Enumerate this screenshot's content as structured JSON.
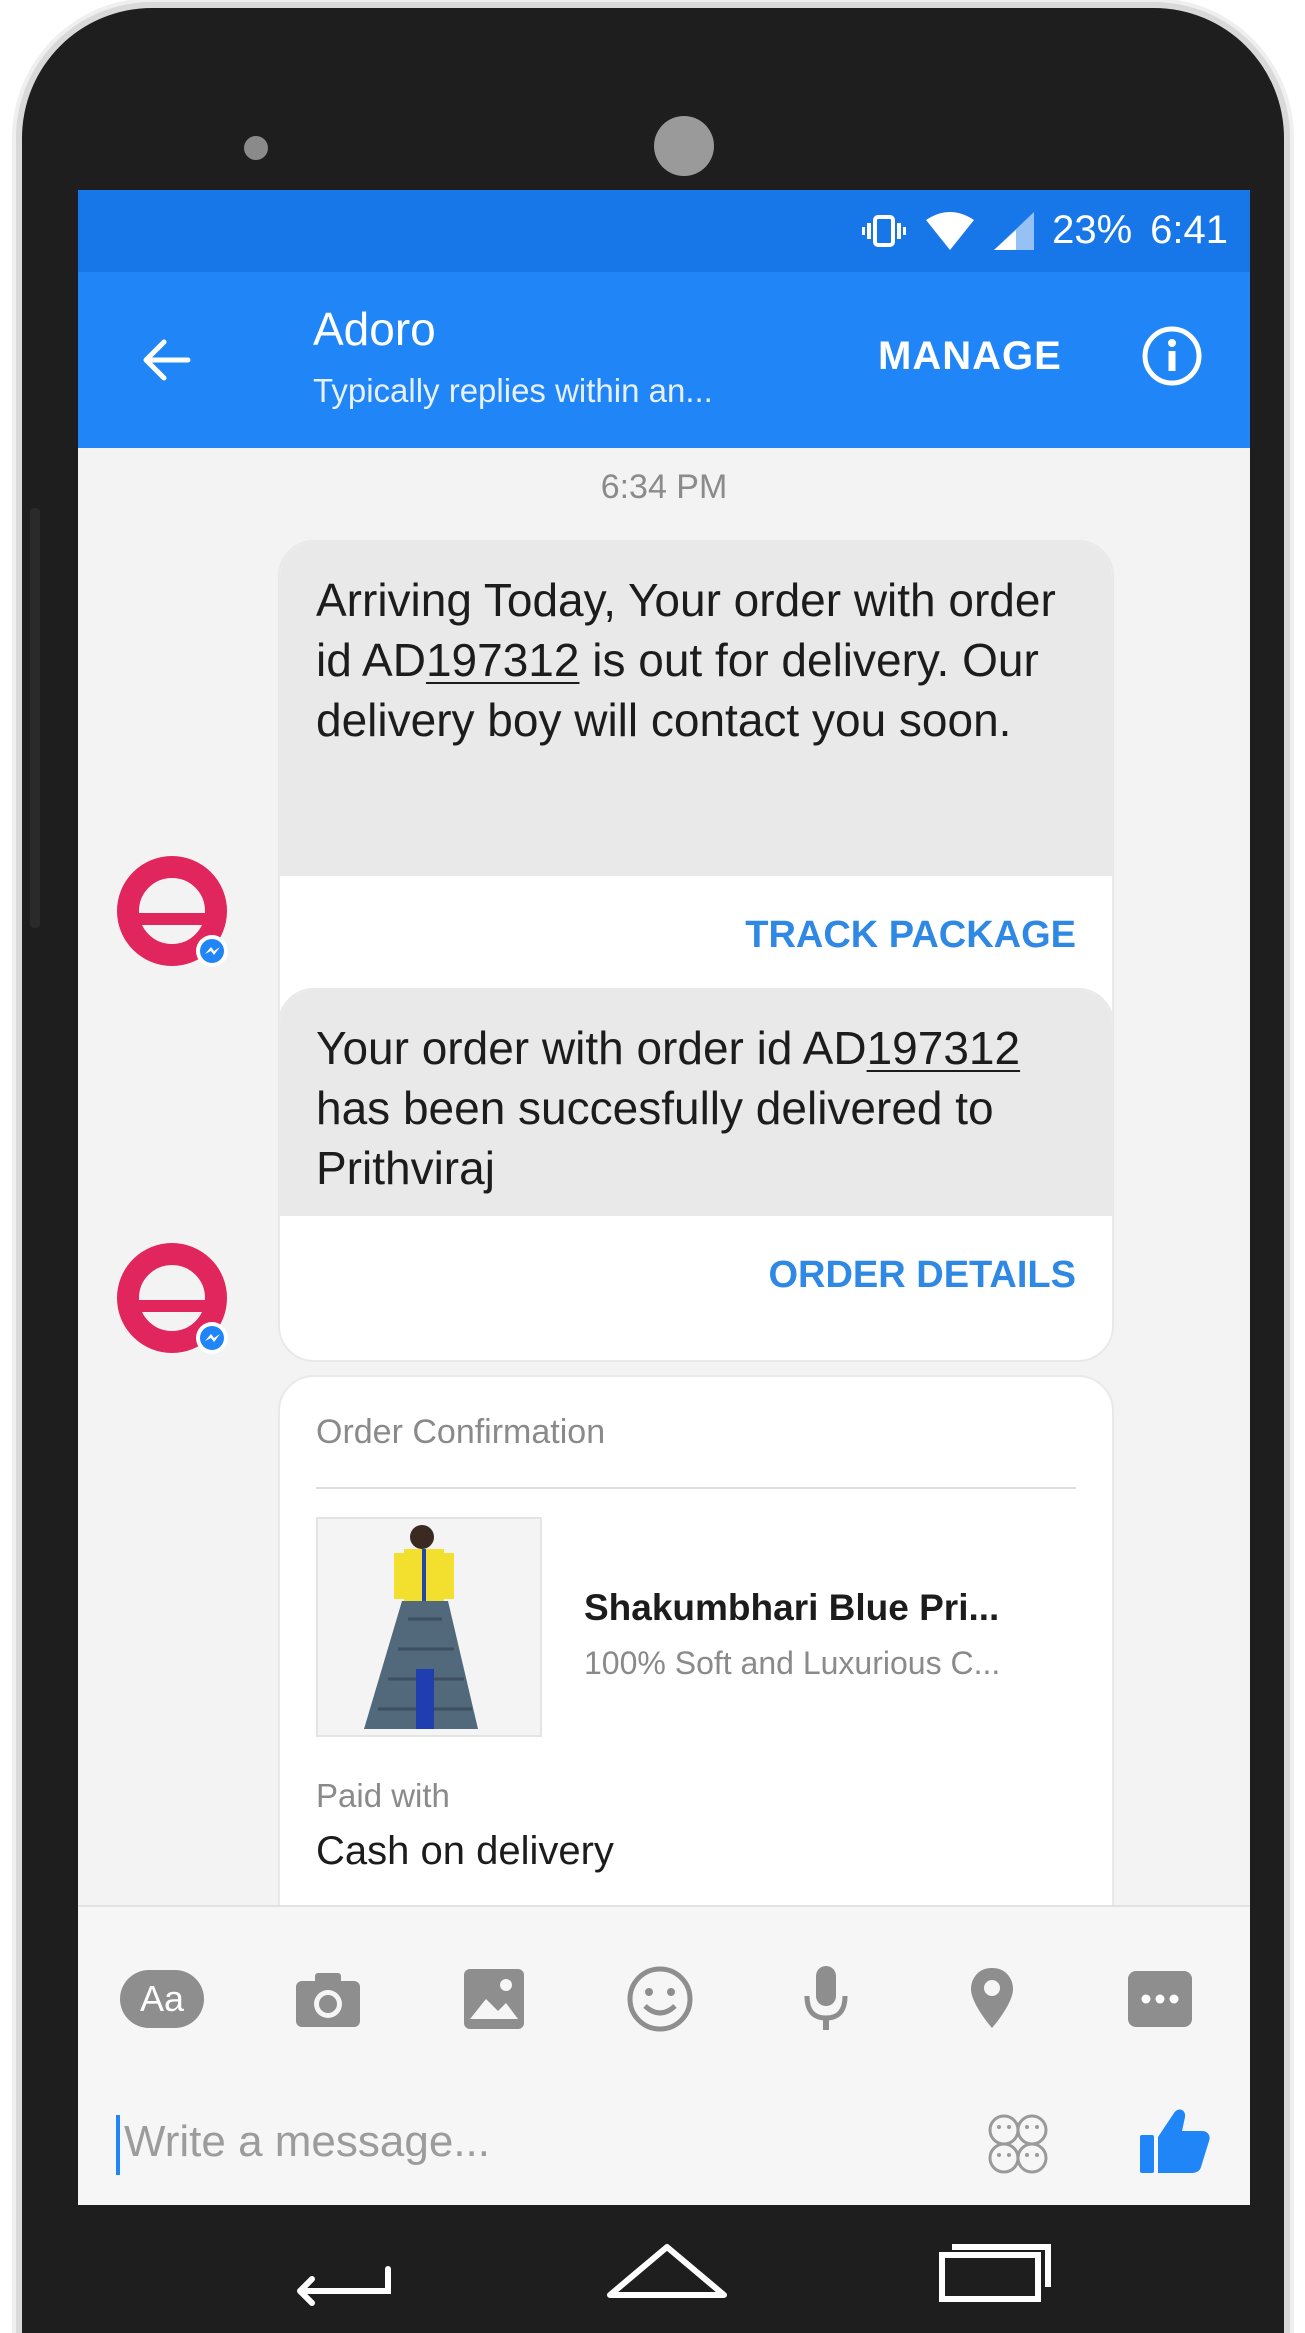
{
  "status_bar": {
    "battery": "23%",
    "time": "6:41",
    "icons": [
      "vibrate-icon",
      "wifi-icon",
      "signal-icon"
    ]
  },
  "header": {
    "title": "Adoro",
    "subtitle": "Typically replies within an...",
    "manage_label": "MANAGE"
  },
  "conversation": {
    "timestamp": "6:34 PM",
    "messages": [
      {
        "text_before": "Arriving Today, Your order with order id AD",
        "order_number": "197312",
        "text_after": " is out for delivery. Our delivery boy will contact you soon.",
        "action": "TRACK PACKAGE"
      },
      {
        "text_before": "Your order with order id AD",
        "order_number": "197312",
        "text_after": " has been succesfully delivered to Prithviraj",
        "action": "ORDER DETAILS"
      }
    ],
    "receipt": {
      "title": "Order Confirmation",
      "product_name": "Shakumbhari Blue Pri...",
      "product_desc": "100% Soft and Luxurious C...",
      "paid_label": "Paid with",
      "paid_value": "Cash on delivery"
    }
  },
  "composer": {
    "aa_label": "Aa",
    "placeholder": "Write a message...",
    "tools": [
      "aa-icon",
      "camera-icon",
      "gallery-icon",
      "emoji-icon",
      "microphone-icon",
      "location-icon",
      "more-icon",
      "stickers-icon",
      "like-icon"
    ]
  },
  "colors": {
    "accent": "#2085f6",
    "status_bar": "#1877e8",
    "action_text": "#2f88e4",
    "avatar": "#e0265c"
  }
}
